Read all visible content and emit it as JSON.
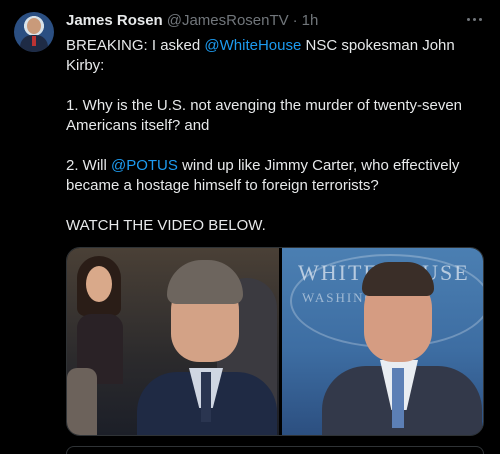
{
  "tweet": {
    "author_name": "James Rosen",
    "author_handle": "@JamesRosenTV",
    "separator": "·",
    "time": "1h",
    "lines": {
      "l1_a": "BREAKING: I asked ",
      "l1_mention": "@WhiteHouse",
      "l1_b": " NSC spokesman John Kirby:",
      "q1": "1. Why is the U.S. not avenging the murder of twenty-seven Americans itself? and",
      "q2_a": "2. Will ",
      "q2_mention": "@POTUS",
      "q2_b": " wind up like Jimmy Carter, who effectively became a hostage himself to foreign terrorists?",
      "cta": "WATCH THE VIDEO BELOW."
    }
  },
  "media": {
    "sign_text": "WHITE HOUSE",
    "sign_subtext": "WASHINGTON"
  },
  "colors": {
    "background": "#000000",
    "text": "#e7e9ea",
    "secondary": "#71767b",
    "link": "#1d9bf0"
  },
  "icons": {
    "more": "more-horizontal-icon",
    "avatar": "profile-avatar"
  }
}
